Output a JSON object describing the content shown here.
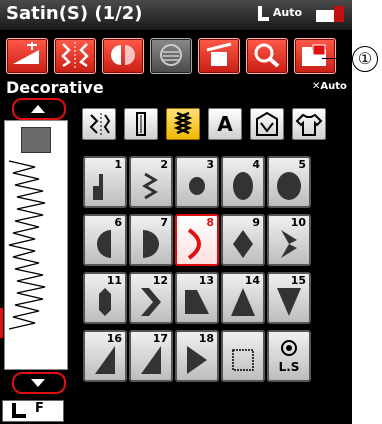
{
  "header": {
    "title": "Satin(S) (1/2)",
    "auto_label": "Auto"
  },
  "toolbar": {
    "buttons": [
      {
        "name": "stitch-length-width-button",
        "icon": "stitch-adjust-icon"
      },
      {
        "name": "mirror-button",
        "icon": "mirror-image-icon"
      },
      {
        "name": "flip-button",
        "icon": "flip-icon"
      },
      {
        "name": "elongation-button",
        "icon": "elongation-icon"
      },
      {
        "name": "thread-cutter-button",
        "icon": "thread-cut-icon"
      },
      {
        "name": "zoom-button",
        "icon": "magnifier-icon"
      },
      {
        "name": "my-folder-button",
        "icon": "folder-icon"
      }
    ]
  },
  "subheader": {
    "category": "Decorative",
    "auto_label": "Auto"
  },
  "presser": {
    "foot_label": "F"
  },
  "categories": [
    {
      "name": "utility",
      "label": ""
    },
    {
      "name": "buttonhole",
      "label": ""
    },
    {
      "name": "satin",
      "label": "",
      "active": true
    },
    {
      "name": "alphabet",
      "label": "A"
    },
    {
      "name": "applique",
      "label": ""
    },
    {
      "name": "garment",
      "label": ""
    }
  ],
  "patterns": [
    {
      "num": "1",
      "shape": "step"
    },
    {
      "num": "2",
      "shape": "zigzag"
    },
    {
      "num": "3",
      "shape": "dot"
    },
    {
      "num": "4",
      "shape": "oval"
    },
    {
      "num": "5",
      "shape": "oval"
    },
    {
      "num": "6",
      "shape": "half-left"
    },
    {
      "num": "7",
      "shape": "half-right"
    },
    {
      "num": "8",
      "shape": "crescent",
      "selected": true
    },
    {
      "num": "9",
      "shape": "diamond"
    },
    {
      "num": "10",
      "shape": "arrow-right"
    },
    {
      "num": "11",
      "shape": "column"
    },
    {
      "num": "12",
      "shape": "chevron"
    },
    {
      "num": "13",
      "shape": "slant"
    },
    {
      "num": "14",
      "shape": "triangle-up"
    },
    {
      "num": "15",
      "shape": "triangle-down"
    },
    {
      "num": "16",
      "shape": "wedge-left"
    },
    {
      "num": "17",
      "shape": "wedge-right"
    },
    {
      "num": "18",
      "shape": "wedge-point"
    },
    {
      "num": "",
      "shape": "square-outline"
    },
    {
      "num": "",
      "shape": "ls",
      "label": "L.S"
    }
  ],
  "callout": {
    "label": "①"
  },
  "colors": {
    "accent_red": "#e01010",
    "selected_yellow": "#f0b800",
    "background": "#000000"
  }
}
